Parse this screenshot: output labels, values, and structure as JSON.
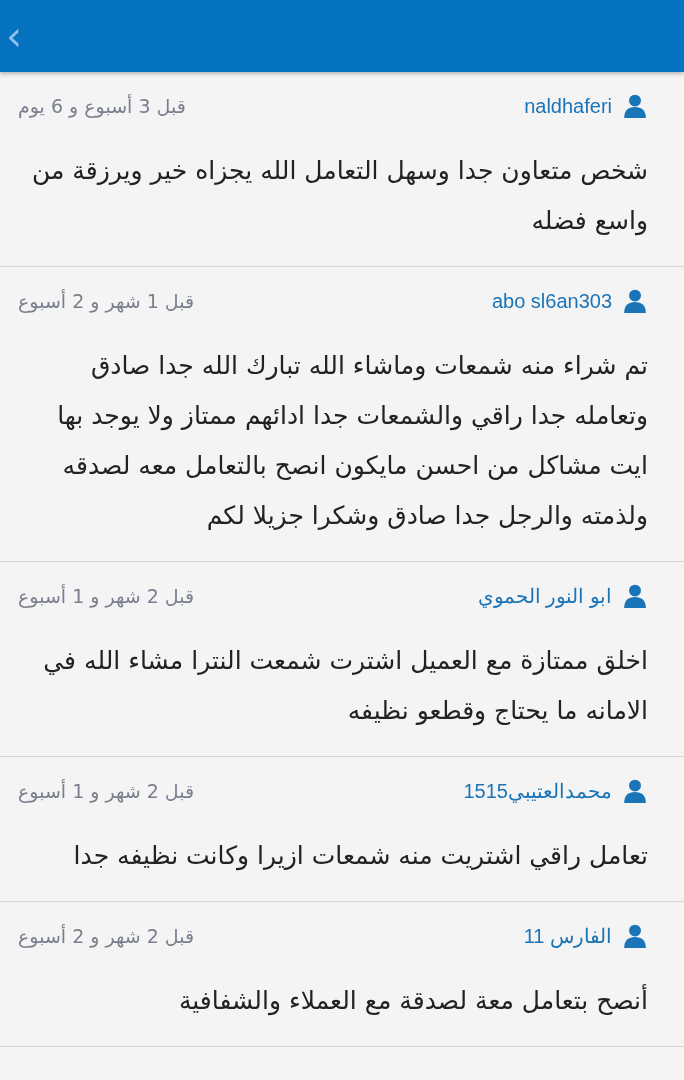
{
  "app_bar": {
    "back": "‹"
  },
  "reviews": [
    {
      "user": "naldhaferi",
      "time": "قبل 3 أسبوع و 6 يوم",
      "text": "شخص متعاون جدا وسهل التعامل الله يجزاه خير ويرزقة من واسع فضله"
    },
    {
      "user": "abo sl6an303",
      "time": "قبل 1 شهر و 2 أسبوع",
      "text": "تم شراء منه شمعات وماشاء الله تبارك الله جدا صادق وتعامله جدا راقي والشمعات جدا ادائهم ممتاز ولا يوجد بها ايت مشاكل من احسن مايكون انصح بالتعامل معه لصدقه ولذمته والرجل جدا صادق وشكرا جزيلا لكم"
    },
    {
      "user": "ابو النور الحموي",
      "time": "قبل 2 شهر و 1 أسبوع",
      "text": "اخلق ممتازة مع العميل اشترت شمعت النترا مشاء الله في الامانه ما يحتاج وقطعو نظيفه"
    },
    {
      "user": "محمدالعتيبي1515",
      "time": "قبل 2 شهر و 1 أسبوع",
      "text": "تعامل راقي اشتريت منه شمعات ازيرا وكانت نظيفه جدا"
    },
    {
      "user": "الفارس 11",
      "time": "قبل 2 شهر و 2 أسبوع",
      "text": "أنصح بتعامل معة لصدقة مع العملاء والشفافية"
    }
  ]
}
